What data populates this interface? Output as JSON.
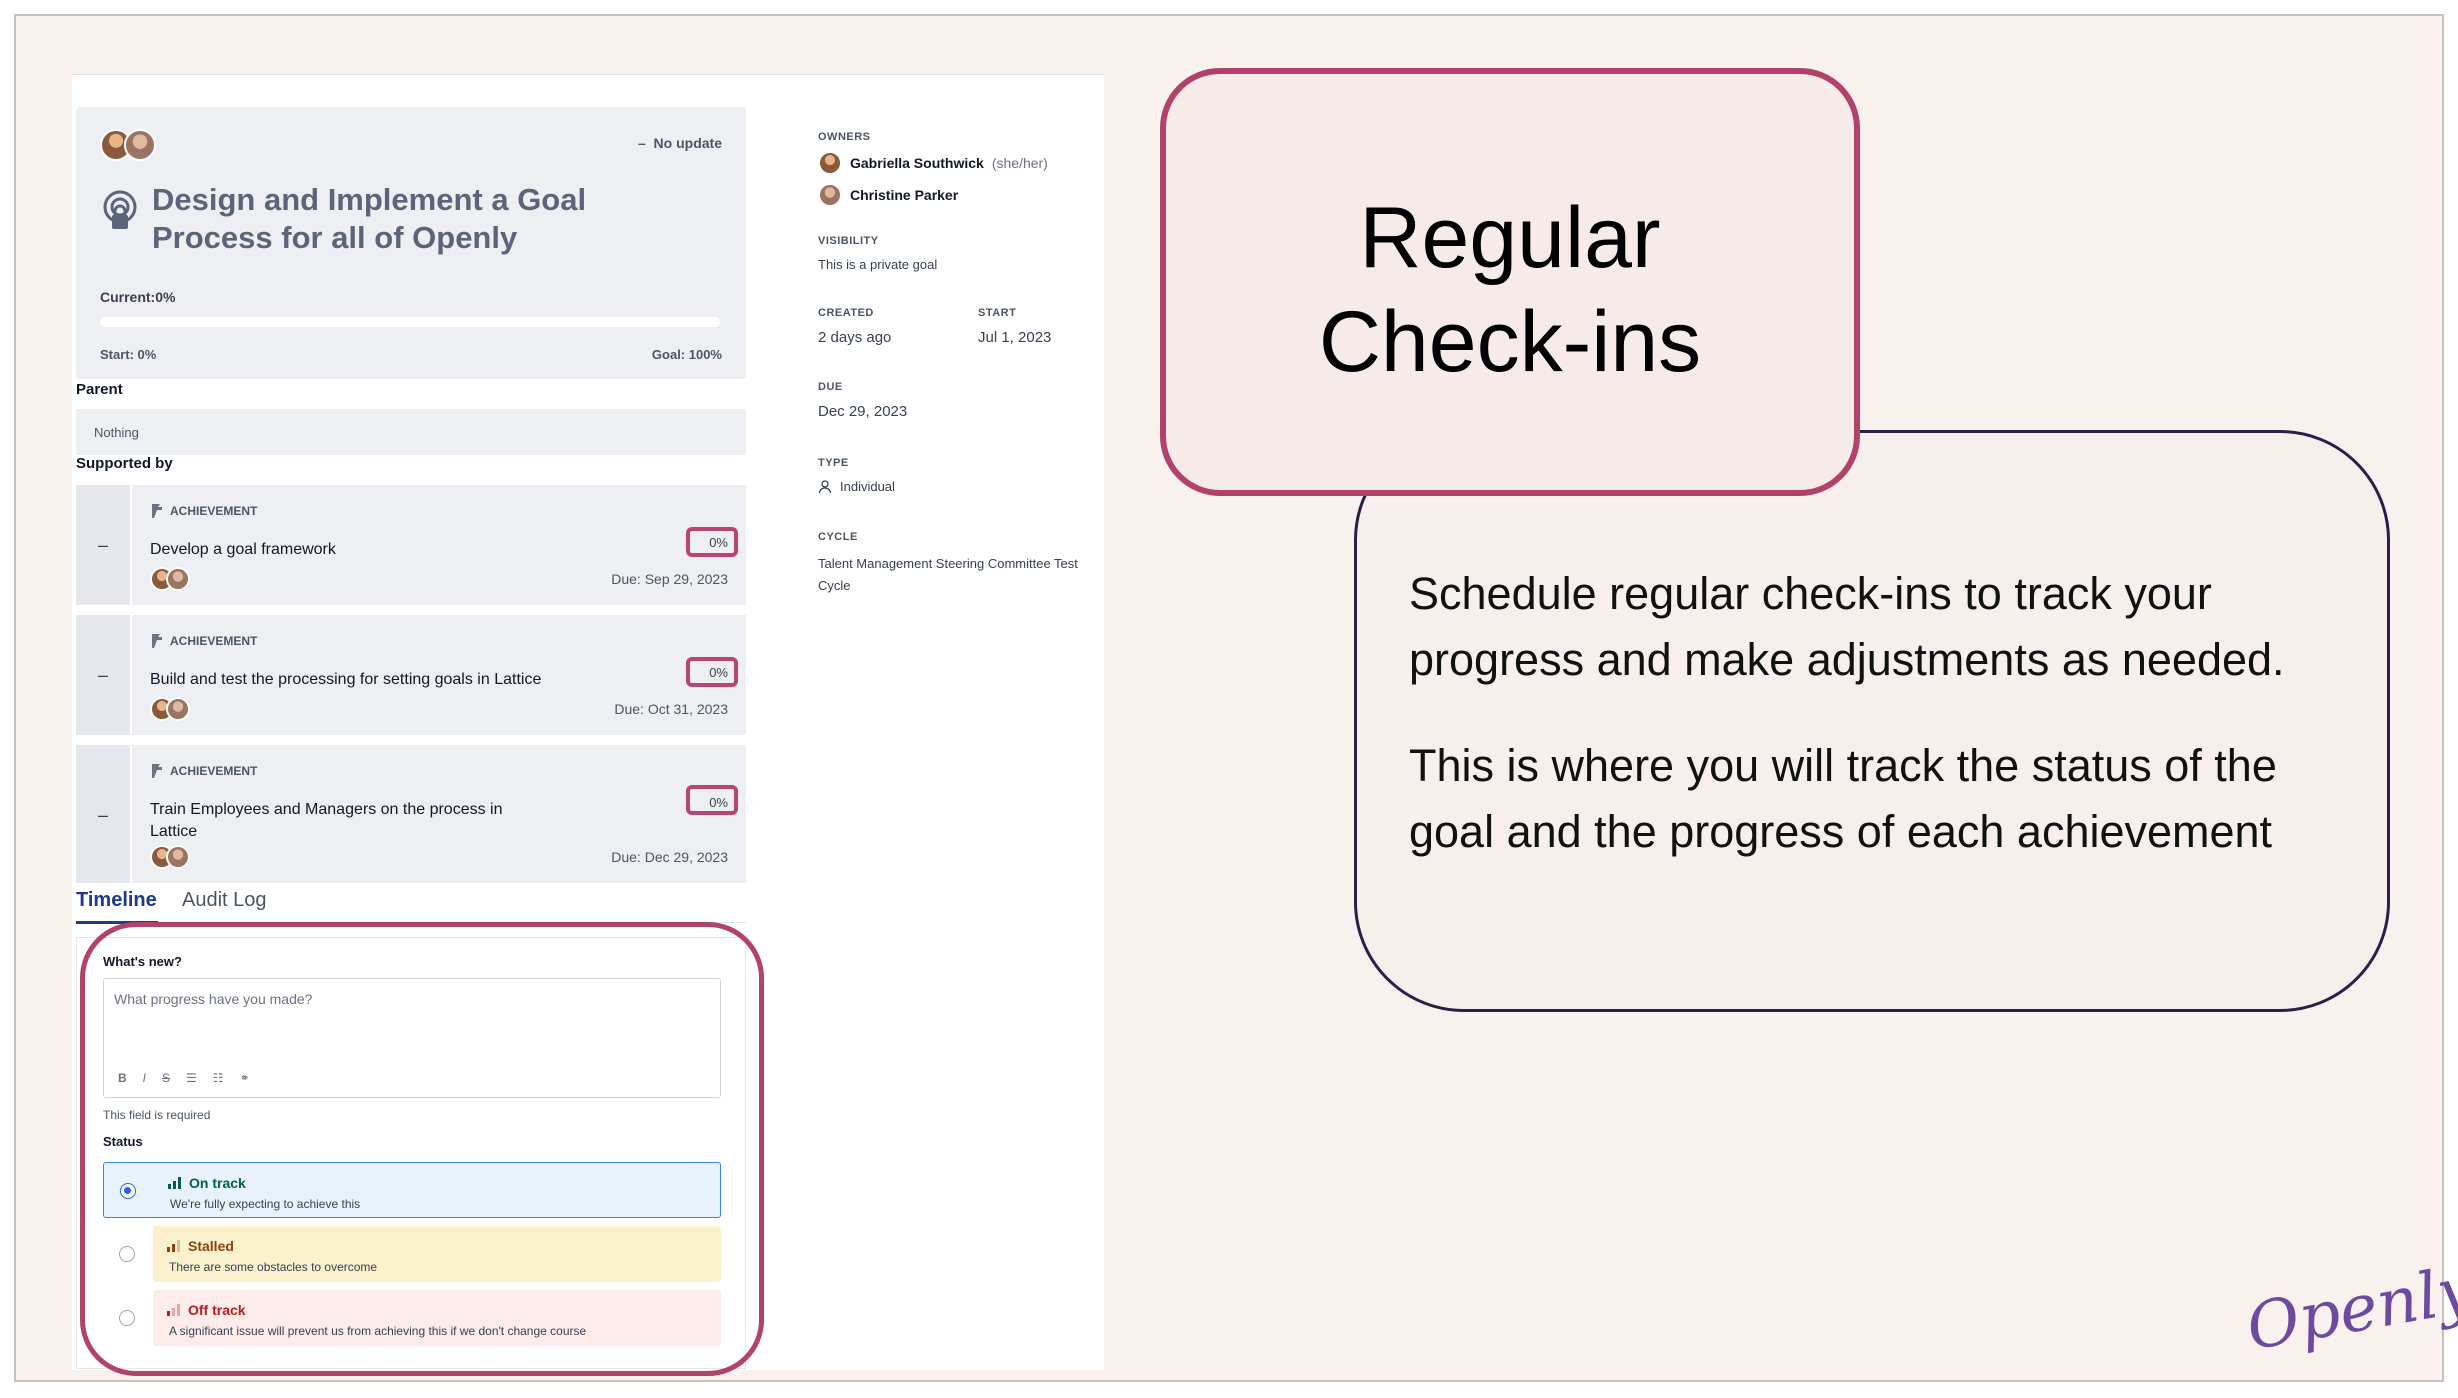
{
  "goal": {
    "status": "No update",
    "title": "Design and Implement a Goal Process for all of Openly",
    "current_label": "Current:0%",
    "progress": 0,
    "start_label": "Start: 0%",
    "goal_label": "Goal: 100%"
  },
  "parent": {
    "label": "Parent",
    "value": "Nothing"
  },
  "supported_by": {
    "label": "Supported by",
    "items": [
      {
        "kind": "ACHIEVEMENT",
        "name": "Develop a goal framework",
        "percent": "0%",
        "due": "Due: Sep 29, 2023"
      },
      {
        "kind": "ACHIEVEMENT",
        "name": "Build and test the processing for setting goals in Lattice",
        "percent": "0%",
        "due": "Due: Oct 31, 2023"
      },
      {
        "kind": "ACHIEVEMENT",
        "name": "Train Employees and Managers on the process in Lattice",
        "percent": "0%",
        "due": "Due: Dec 29, 2023"
      }
    ]
  },
  "tabs": [
    "Timeline",
    "Audit Log"
  ],
  "checkin": {
    "whats_new_label": "What's new?",
    "placeholder": "What progress have you made?",
    "toolbar": [
      "B",
      "I",
      "S",
      "☰",
      "☷",
      "⚭"
    ],
    "required_note": "This field is required",
    "status_label": "Status",
    "options": [
      {
        "title": "On track",
        "desc": "We're fully expecting to achieve this"
      },
      {
        "title": "Stalled",
        "desc": "There are some obstacles to overcome"
      },
      {
        "title": "Off track",
        "desc": "A significant issue will prevent us from achieving this if we don't change course"
      }
    ]
  },
  "meta": {
    "owners_label": "OWNERS",
    "owners": [
      {
        "name": "Gabriella Southwick",
        "pronouns": "(she/her)"
      },
      {
        "name": "Christine Parker",
        "pronouns": ""
      }
    ],
    "visibility_label": "VISIBILITY",
    "visibility": "This is a private goal",
    "created_label": "CREATED",
    "created": "2 days ago",
    "start_label": "START",
    "start": "Jul 1, 2023",
    "due_label": "DUE",
    "due": "Dec 29, 2023",
    "type_label": "TYPE",
    "type": "Individual",
    "cycle_label": "CYCLE",
    "cycle": "Talent Management Steering Committee Test Cycle"
  },
  "callout": {
    "title_line1": "Regular",
    "title_line2": "Check-ins",
    "para1": "Schedule regular check-ins to track your progress and make adjustments as needed.",
    "para2": "This is where you will track the status of the goal and the progress of each achievement"
  },
  "logo": "Openly",
  "colors": {
    "accent": "#b0426b",
    "brand": "#6d4aa0",
    "on_track": "#065f46",
    "stalled": "#92400e",
    "off_track": "#b91c1c"
  }
}
